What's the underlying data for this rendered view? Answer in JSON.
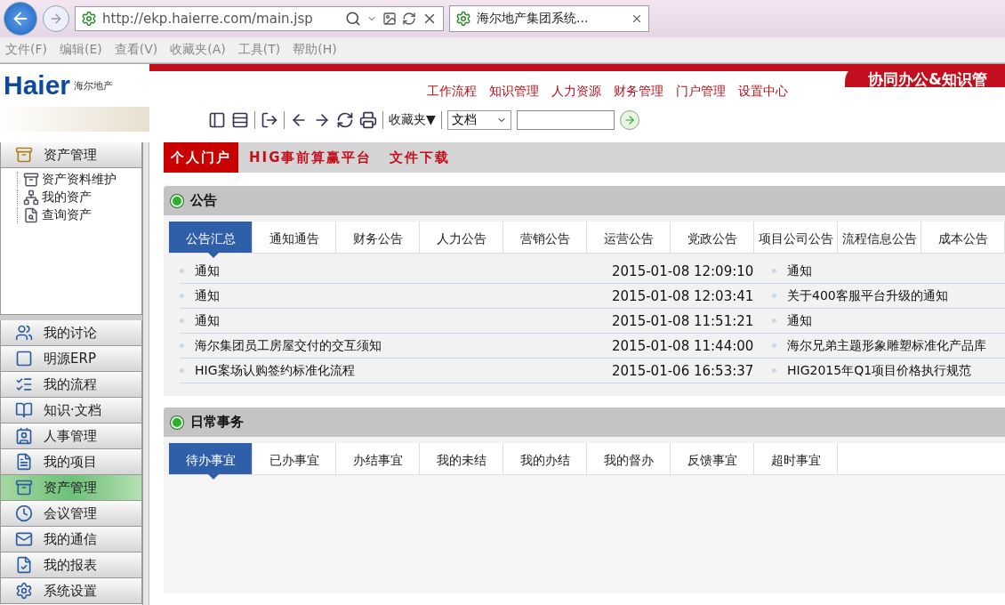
{
  "browser": {
    "address": "http://ekp.haierre.com/main.jsp",
    "tab": {
      "title": "海尔地产集团系统..."
    }
  },
  "menu": [
    "文件(F)",
    "编辑(E)",
    "查看(V)",
    "收藏夹(A)",
    "工具(T)",
    "帮助(H)"
  ],
  "header": {
    "logo": "Haier",
    "logo_sub": "海尔地产",
    "banner": "协同办公&知识管",
    "nav": [
      "工作流程",
      "知识管理",
      "人力资源",
      "财务管理",
      "门户管理",
      "设置中心"
    ],
    "favorites": "收藏夹▼",
    "search_scope": "文档"
  },
  "portal_tabs": [
    {
      "label": "个人门户",
      "selected": true
    },
    {
      "label": "HIG事前算赢平台",
      "selected": false
    },
    {
      "label": "文件下载",
      "selected": false
    }
  ],
  "sidebar": {
    "group": {
      "label": "资产管理",
      "children": [
        "资产资料维护",
        "我的资产",
        "查询资产"
      ]
    },
    "items": [
      {
        "label": "我的讨论",
        "selected": false
      },
      {
        "label": "明源ERP",
        "selected": false
      },
      {
        "label": "我的流程",
        "selected": false
      },
      {
        "label": "知识·文档",
        "selected": false
      },
      {
        "label": "人事管理",
        "selected": false
      },
      {
        "label": "我的项目",
        "selected": false
      },
      {
        "label": "资产管理",
        "selected": true
      },
      {
        "label": "会议管理",
        "selected": false
      },
      {
        "label": "我的通信",
        "selected": false
      },
      {
        "label": "我的报表",
        "selected": false
      },
      {
        "label": "系统设置",
        "selected": false
      }
    ]
  },
  "panels": [
    {
      "title": "公告",
      "tabs": [
        {
          "label": "公告汇总",
          "selected": true
        },
        {
          "label": "通知通告",
          "selected": false
        },
        {
          "label": "财务公告",
          "selected": false
        },
        {
          "label": "人力公告",
          "selected": false
        },
        {
          "label": "营销公告",
          "selected": false
        },
        {
          "label": "运营公告",
          "selected": false
        },
        {
          "label": "党政公告",
          "selected": false
        },
        {
          "label": "项目公司公告",
          "selected": false
        },
        {
          "label": "流程信息公告",
          "selected": false
        },
        {
          "label": "成本公告",
          "selected": false
        }
      ],
      "rows": [
        {
          "title": "通知",
          "time": "2015-01-08 12:09:10",
          "title_2": "通知"
        },
        {
          "title": "通知",
          "time": "2015-01-08 12:03:41",
          "title_2": "关于400客服平台升级的通知"
        },
        {
          "title": "通知",
          "time": "2015-01-08 11:51:21",
          "title_2": "通知"
        },
        {
          "title": "海尔集团员工房屋交付的交互须知",
          "time": "2015-01-08 11:44:00",
          "title_2": "海尔兄弟主题形象雕塑标准化产品库"
        },
        {
          "title": "HIG案场认购签约标准化流程",
          "time": "2015-01-06 16:53:37",
          "title_2": "HIG2015年Q1项目价格执行规范"
        }
      ]
    },
    {
      "title": "日常事务",
      "tabs": [
        {
          "label": "待办事宜",
          "selected": true
        },
        {
          "label": "已办事宜",
          "selected": false
        },
        {
          "label": "办结事宜",
          "selected": false
        },
        {
          "label": "我的未结",
          "selected": false
        },
        {
          "label": "我的办结",
          "selected": false
        },
        {
          "label": "我的督办",
          "selected": false
        },
        {
          "label": "反馈事宜",
          "selected": false
        },
        {
          "label": "超时事宜",
          "selected": false
        }
      ]
    }
  ]
}
